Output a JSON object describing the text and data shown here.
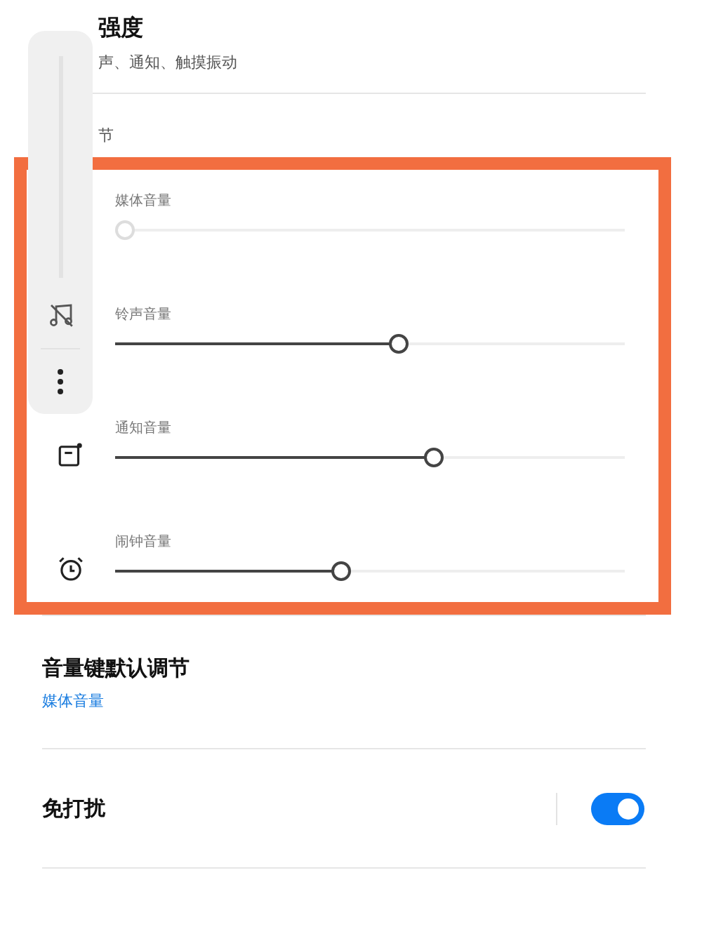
{
  "vibration": {
    "title": "强度",
    "subtitle": "声、通知、触摸振动"
  },
  "section_label": "节",
  "volume_sliders": [
    {
      "label": "媒体音量",
      "level": 0,
      "disabled": true
    },
    {
      "label": "铃声音量",
      "level": 0.56,
      "disabled": false
    },
    {
      "label": "通知音量",
      "level": 0.63,
      "disabled": false
    },
    {
      "label": "闹钟音量",
      "level": 0.44,
      "disabled": false
    }
  ],
  "side_panel": {
    "level": 0
  },
  "volume_key": {
    "title": "音量键默认调节",
    "value": "媒体音量"
  },
  "do_not_disturb": {
    "title": "免打扰",
    "on": true
  }
}
